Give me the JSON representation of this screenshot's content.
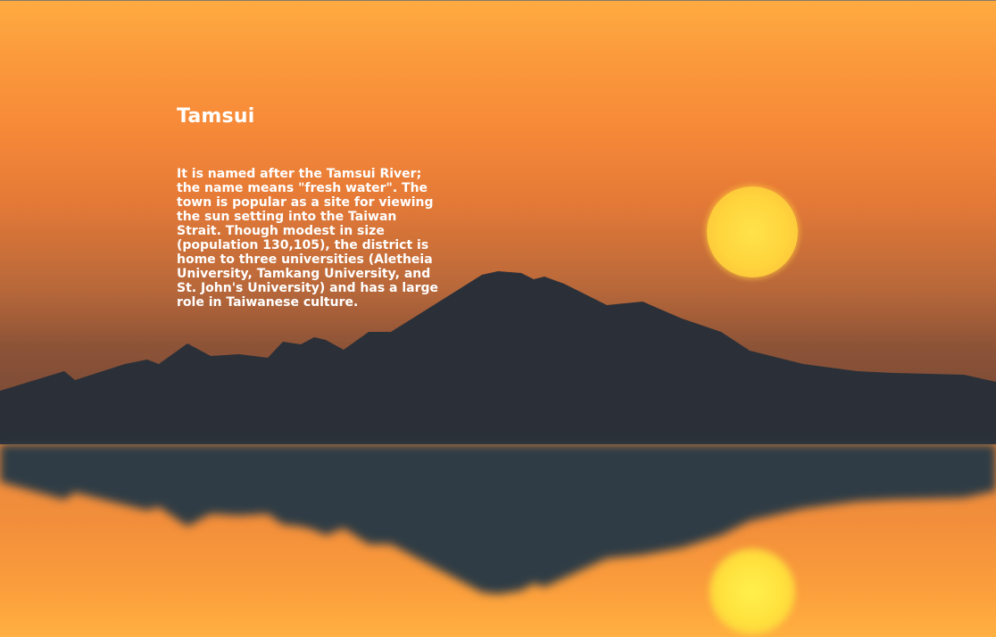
{
  "location": {
    "title": "Tamsui",
    "description": "It is named after the Tamsui River; the name means \"fresh water\". The town is popular as a site for viewing the sun setting into the Taiwan Strait. Though modest in size (population 130,105), the district is home to three universities (Aletheia University, Tamkang University, and St. John's University) and has a large role in Taiwanese culture."
  },
  "scene": {
    "subject": "sunset over mountains reflected in water",
    "colors": {
      "sky_top": "#ffab40",
      "sky_bottom": "#6e4536",
      "sun": "#ffd43c",
      "mountain": "#2b3038",
      "reflection": "#2f3c45",
      "water": "#f28e3b",
      "text": "#ffffff"
    }
  }
}
